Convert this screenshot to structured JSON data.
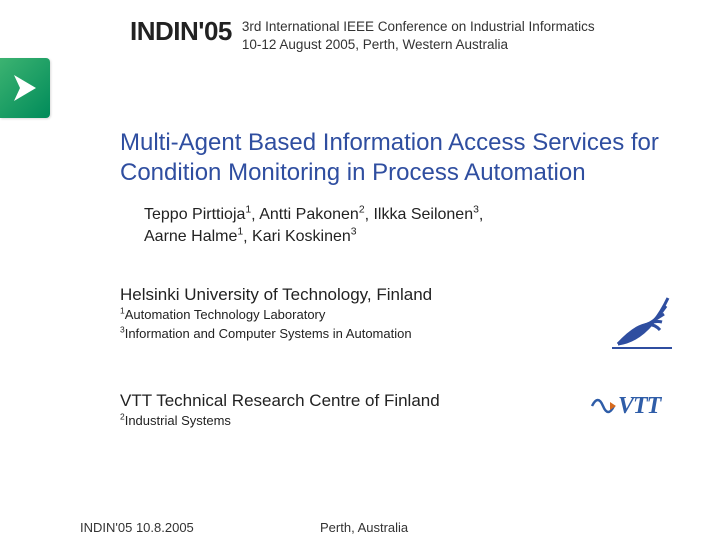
{
  "header": {
    "conf_short": "INDIN'05",
    "conf_long_line1": "3rd International IEEE Conference on Industrial Informatics",
    "conf_long_line2": "10-12 August 2005, Perth, Western Australia"
  },
  "title": "Multi-Agent Based Information Access Services for Condition Monitoring in Process Automation",
  "authors": [
    {
      "name": "Teppo Pirttioja",
      "sup": "1"
    },
    {
      "name": "Antti Pakonen",
      "sup": "2"
    },
    {
      "name": "Ilkka Seilonen",
      "sup": "3"
    },
    {
      "name": "Aarne Halme",
      "sup": "1"
    },
    {
      "name": "Kari Koskinen",
      "sup": "3"
    }
  ],
  "affiliation1": {
    "name": "Helsinki University of Technology, Finland",
    "labs": [
      {
        "sup": "1",
        "text": "Automation Technology Laboratory"
      },
      {
        "sup": "3",
        "text": "Information and Computer Systems in Automation"
      }
    ]
  },
  "affiliation2": {
    "name": "VTT Technical Research Centre of Finland",
    "labs": [
      {
        "sup": "2",
        "text": "Industrial Systems"
      }
    ]
  },
  "logos": {
    "hut_icon": "hut-logo",
    "vtt_text": "VTT"
  },
  "footer": {
    "left": "INDIN'05 10.8.2005",
    "center": "Perth, Australia"
  },
  "colors": {
    "title": "#2f4ea0",
    "vtt": "#2f5da8"
  }
}
